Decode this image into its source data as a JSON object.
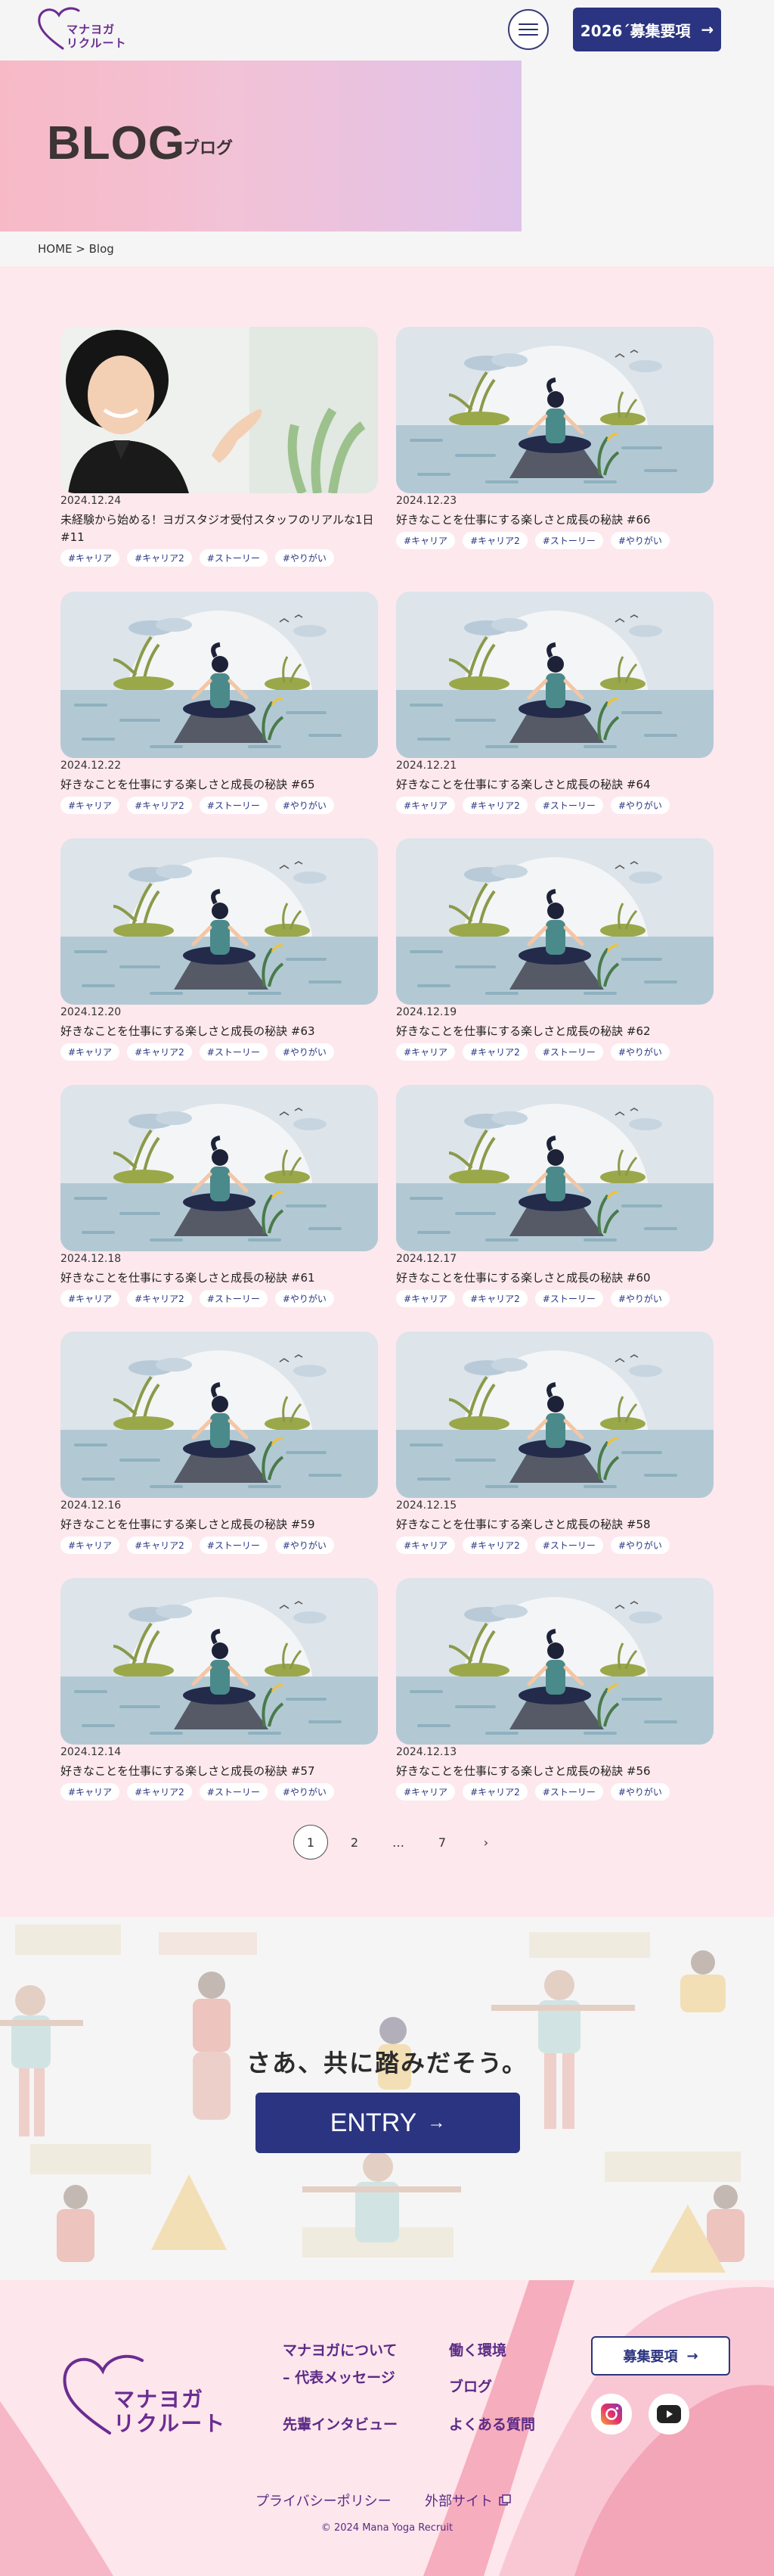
{
  "header": {
    "brand_line1": "マナヨガ",
    "brand_line2": "リクルート",
    "recruit_button": "2026´募集要項",
    "arrow": "→"
  },
  "hero": {
    "title": "BLOG",
    "subtitle": "ブログ"
  },
  "breadcrumb": "HOME > Blog",
  "posts": [
    {
      "date": "2024.12.24",
      "title": "未経験から始める！ヨガスタジオ受付スタッフのリアルな1日#11",
      "tags": [
        "#キャリア",
        "#キャリア2",
        "#ストーリー",
        "#やりがい"
      ]
    },
    {
      "date": "2024.12.23",
      "title": "好きなことを仕事にする楽しさと成長の秘訣 #66",
      "tags": [
        "#キャリア",
        "#キャリア2",
        "#ストーリー",
        "#やりがい"
      ]
    },
    {
      "date": "2024.12.22",
      "title": "好きなことを仕事にする楽しさと成長の秘訣 #65",
      "tags": [
        "#キャリア",
        "#キャリア2",
        "#ストーリー",
        "#やりがい"
      ]
    },
    {
      "date": "2024.12.21",
      "title": "好きなことを仕事にする楽しさと成長の秘訣 #64",
      "tags": [
        "#キャリア",
        "#キャリア2",
        "#ストーリー",
        "#やりがい"
      ]
    },
    {
      "date": "2024.12.20",
      "title": "好きなことを仕事にする楽しさと成長の秘訣 #63",
      "tags": [
        "#キャリア",
        "#キャリア2",
        "#ストーリー",
        "#やりがい"
      ]
    },
    {
      "date": "2024.12.19",
      "title": "好きなことを仕事にする楽しさと成長の秘訣 #62",
      "tags": [
        "#キャリア",
        "#キャリア2",
        "#ストーリー",
        "#やりがい"
      ]
    },
    {
      "date": "2024.12.18",
      "title": "好きなことを仕事にする楽しさと成長の秘訣 #61",
      "tags": [
        "#キャリア",
        "#キャリア2",
        "#ストーリー",
        "#やりがい"
      ]
    },
    {
      "date": "2024.12.17",
      "title": "好きなことを仕事にする楽しさと成長の秘訣 #60",
      "tags": [
        "#キャリア",
        "#キャリア2",
        "#ストーリー",
        "#やりがい"
      ]
    },
    {
      "date": "2024.12.16",
      "title": "好きなことを仕事にする楽しさと成長の秘訣 #59",
      "tags": [
        "#キャリア",
        "#キャリア2",
        "#ストーリー",
        "#やりがい"
      ]
    },
    {
      "date": "2024.12.15",
      "title": "好きなことを仕事にする楽しさと成長の秘訣 #58",
      "tags": [
        "#キャリア",
        "#キャリア2",
        "#ストーリー",
        "#やりがい"
      ]
    },
    {
      "date": "2024.12.14",
      "title": "好きなことを仕事にする楽しさと成長の秘訣 #57",
      "tags": [
        "#キャリア",
        "#キャリア2",
        "#ストーリー",
        "#やりがい"
      ]
    },
    {
      "date": "2024.12.13",
      "title": "好きなことを仕事にする楽しさと成長の秘訣 #56",
      "tags": [
        "#キャリア",
        "#キャリア2",
        "#ストーリー",
        "#やりがい"
      ]
    }
  ],
  "pagination": {
    "pages": [
      "1",
      "2",
      "…",
      "7"
    ],
    "current": "1",
    "next": "›"
  },
  "entry": {
    "heading": "さあ、共に踏みだそう。",
    "button": "ENTRY",
    "arrow": "→"
  },
  "footer": {
    "brand_line1": "マナヨガ",
    "brand_line2": "リクルート",
    "links": {
      "about": "マナヨガについて",
      "message": "– 代表メッセージ",
      "interview": "先輩インタビュー",
      "environment": "働く環境",
      "blog": "ブログ",
      "faq": "よくある質問"
    },
    "recruit_button": "募集要項",
    "arrow": "→",
    "privacy": "プライバシーポリシー",
    "external": "外部サイト",
    "copyright": "© 2024 Mana Yoga Recruit"
  },
  "colors": {
    "navy": "#2b3480",
    "purple": "#6b2c91",
    "pink_bg": "#fde8ee"
  },
  "icons": [
    "heart-logo-icon",
    "hamburger-icon",
    "arrow-right-icon",
    "instagram-icon",
    "youtube-icon",
    "external-link-icon"
  ]
}
